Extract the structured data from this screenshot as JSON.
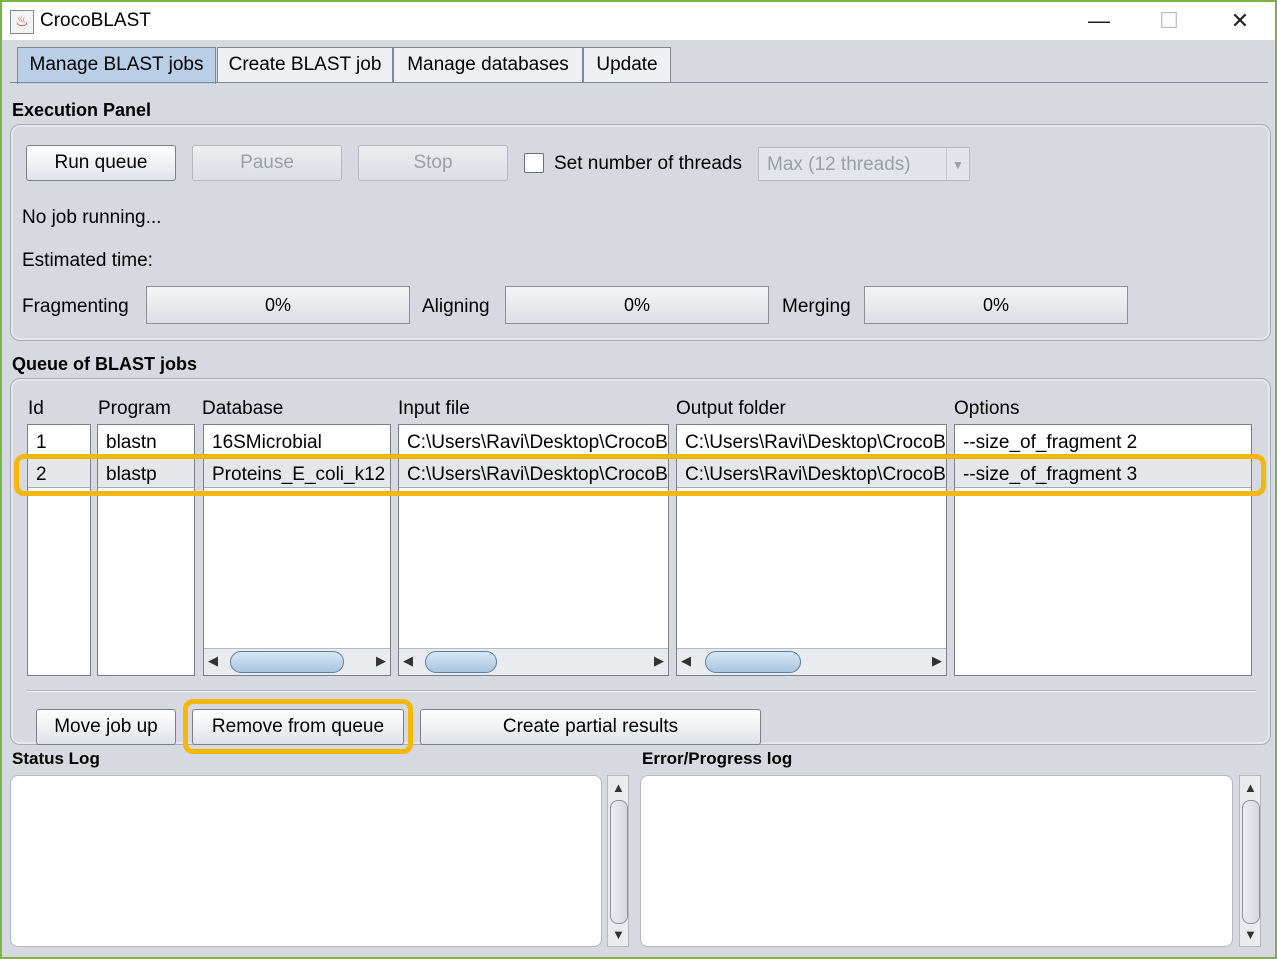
{
  "window": {
    "title": "CrocoBLAST",
    "minimize": "—",
    "maximize": "☐",
    "close": "✕"
  },
  "tabs": [
    {
      "label": "Manage BLAST jobs",
      "active": true
    },
    {
      "label": "Create BLAST job"
    },
    {
      "label": "Manage databases"
    },
    {
      "label": "Update"
    }
  ],
  "execution": {
    "title": "Execution Panel",
    "run_label": "Run queue",
    "pause_label": "Pause",
    "stop_label": "Stop",
    "threads_label": "Set number of threads",
    "threads_value": "Max (12 threads)",
    "status": "No job running...",
    "estimated": "Estimated time:",
    "fragmenting_label": "Fragmenting",
    "fragmenting_value": "0%",
    "aligning_label": "Aligning",
    "aligning_value": "0%",
    "merging_label": "Merging",
    "merging_value": "0%"
  },
  "queue": {
    "title": "Queue of BLAST jobs",
    "headers": {
      "id": "Id",
      "program": "Program",
      "database": "Database",
      "input": "Input file",
      "output": "Output folder",
      "options": "Options"
    },
    "rows": [
      {
        "id": "1",
        "program": "blastn",
        "database": "16SMicrobial",
        "input": "C:\\Users\\Ravi\\Desktop\\CrocoBLAST",
        "output": "C:\\Users\\Ravi\\Desktop\\CrocoBLAST",
        "options": "--size_of_fragment 2"
      },
      {
        "id": "2",
        "program": "blastp",
        "database": "Proteins_E_coli_k12",
        "input": "C:\\Users\\Ravi\\Desktop\\CrocoBLAST",
        "output": "C:\\Users\\Ravi\\Desktop\\CrocoBLAST",
        "options": "--size_of_fragment 3"
      }
    ],
    "move_up_label": "Move job up",
    "remove_label": "Remove from queue",
    "partial_label": "Create partial results"
  },
  "logs": {
    "status_title": "Status Log",
    "error_title": "Error/Progress log"
  },
  "arrows": {
    "left": "◀",
    "right": "▶",
    "up": "▲",
    "down": "▼"
  }
}
